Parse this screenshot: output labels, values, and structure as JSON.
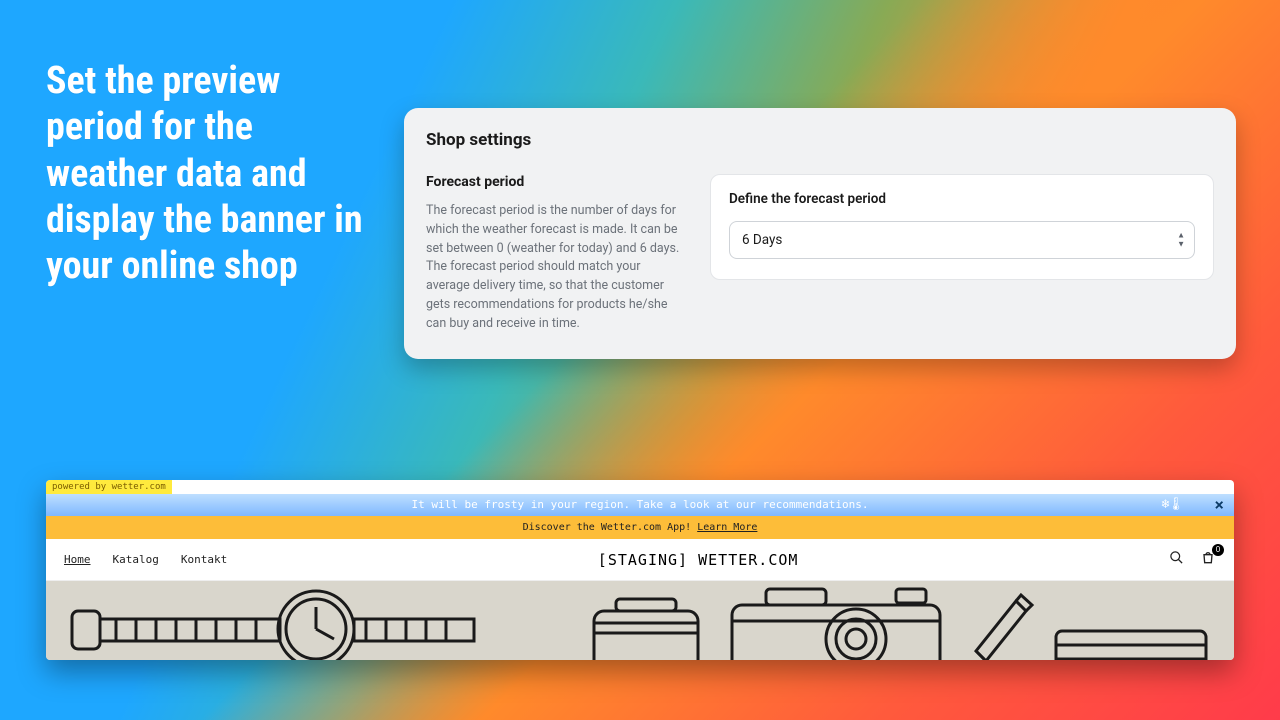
{
  "hero_text": "Set the preview period for the weather data and display the banner in your online shop",
  "settings": {
    "title": "Shop settings",
    "section_heading": "Forecast period",
    "description": "The forecast period is the number of days for which the weather forecast is made. It can be set between 0 (weather for today) and 6 days. The forecast period should match your average delivery time, so that the customer gets recommendations for products he/she can buy and receive in time.",
    "field_label": "Define the forecast period",
    "select_value": "6 Days"
  },
  "shop": {
    "powered_label": "powered by wetter.com",
    "banner_text": "It will be frosty in your region. Take a look at our recommendations.",
    "weather_icon": "snowflake-thermometer-icon",
    "promo_text": "Discover the Wetter.com App! ",
    "promo_link": "Learn More",
    "nav": {
      "links": [
        "Home",
        "Katalog",
        "Kontakt"
      ],
      "brand": "[STAGING] WETTER.COM",
      "cart_count": "0"
    }
  }
}
